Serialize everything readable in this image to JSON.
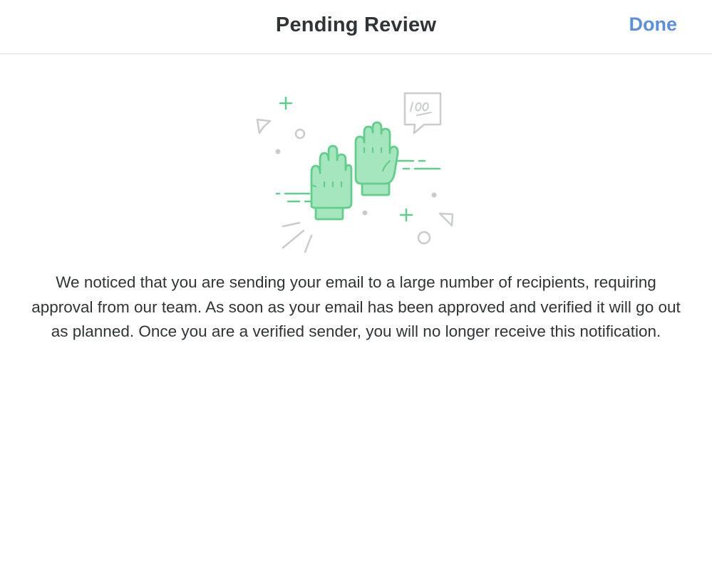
{
  "header": {
    "title": "Pending Review",
    "done_label": "Done"
  },
  "illustration": {
    "icon": "high-five-hands-icon",
    "badge_text": "100",
    "accent_color": "#5fcf8a",
    "fill_color": "#a6e6be",
    "decor_color": "#c9ccce"
  },
  "body": {
    "message": "We noticed that you are sending your email to a large number of recipients, requiring approval from our team. As soon as your email has been approved and verified it will go out as planned. Once you are a verified sender, you will no longer receive this notification."
  },
  "colors": {
    "link": "#5b8fe0",
    "text": "#2f3437",
    "divider": "#dcdee0"
  }
}
